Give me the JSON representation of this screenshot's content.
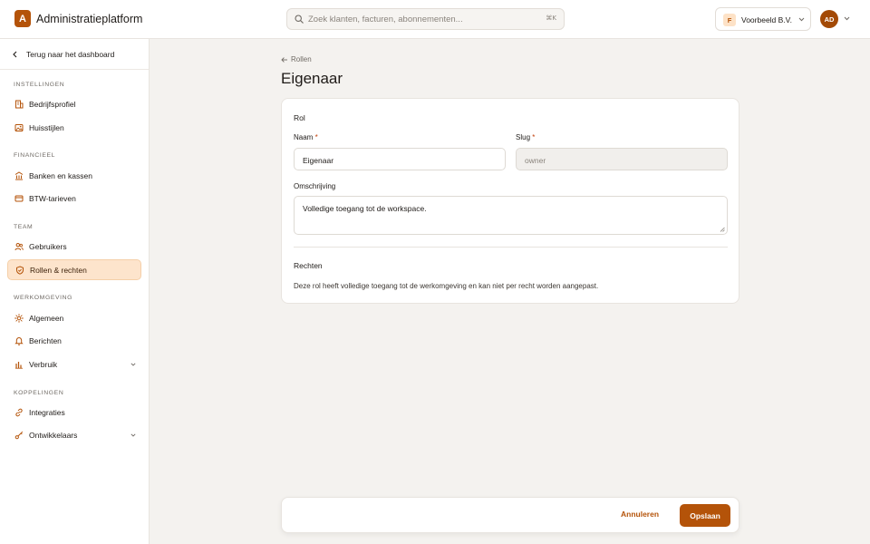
{
  "app": {
    "logo_letter": "A",
    "title": "Administratieplatform"
  },
  "search": {
    "placeholder": "Zoek klanten, facturen, abonnementen...",
    "shortcut": "⌘K"
  },
  "org": {
    "badge": "F",
    "name": "Voorbeeld B.V."
  },
  "user": {
    "initials": "AD"
  },
  "sidebar": {
    "back_label": "Terug naar het dashboard",
    "sections": [
      {
        "label": "INSTELLINGEN",
        "items": [
          {
            "label": "Bedrijfsprofiel",
            "icon": "building-icon"
          },
          {
            "label": "Huisstijlen",
            "icon": "image-icon"
          }
        ]
      },
      {
        "label": "FINANCIEEL",
        "items": [
          {
            "label": "Banken en kassen",
            "icon": "bank-icon"
          },
          {
            "label": "BTW-tarieven",
            "icon": "card-icon"
          }
        ]
      },
      {
        "label": "TEAM",
        "items": [
          {
            "label": "Gebruikers",
            "icon": "users-icon"
          },
          {
            "label": "Rollen & rechten",
            "icon": "shield-icon",
            "active": true
          }
        ]
      },
      {
        "label": "WERKOMGEVING",
        "items": [
          {
            "label": "Algemeen",
            "icon": "sun-icon"
          },
          {
            "label": "Berichten",
            "icon": "bell-icon"
          },
          {
            "label": "Verbruik",
            "icon": "bar-chart-icon",
            "expandable": true
          }
        ]
      },
      {
        "label": "KOPPELINGEN",
        "items": [
          {
            "label": "Integraties",
            "icon": "link-icon"
          },
          {
            "label": "Ontwikkelaars",
            "icon": "key-icon",
            "expandable": true
          }
        ]
      }
    ]
  },
  "breadcrumb": {
    "label": "Rollen"
  },
  "page": {
    "title": "Eigenaar"
  },
  "form": {
    "section_role": "Rol",
    "name_label": "Naam",
    "name_value": "Eigenaar",
    "slug_label": "Slug",
    "slug_value": "owner",
    "required_mark": "*",
    "description_label": "Omschrijving",
    "description_value": "Volledige toegang tot de workspace.",
    "section_rights": "Rechten",
    "rights_description": "Deze rol heeft volledige toegang tot de werkomgeving en kan niet per recht worden aangepast."
  },
  "actions": {
    "cancel": "Annuleren",
    "save": "Opslaan"
  },
  "colors": {
    "accent": "#b45309",
    "active_bg": "#fde4cc",
    "page_bg": "#f4f2ef"
  }
}
